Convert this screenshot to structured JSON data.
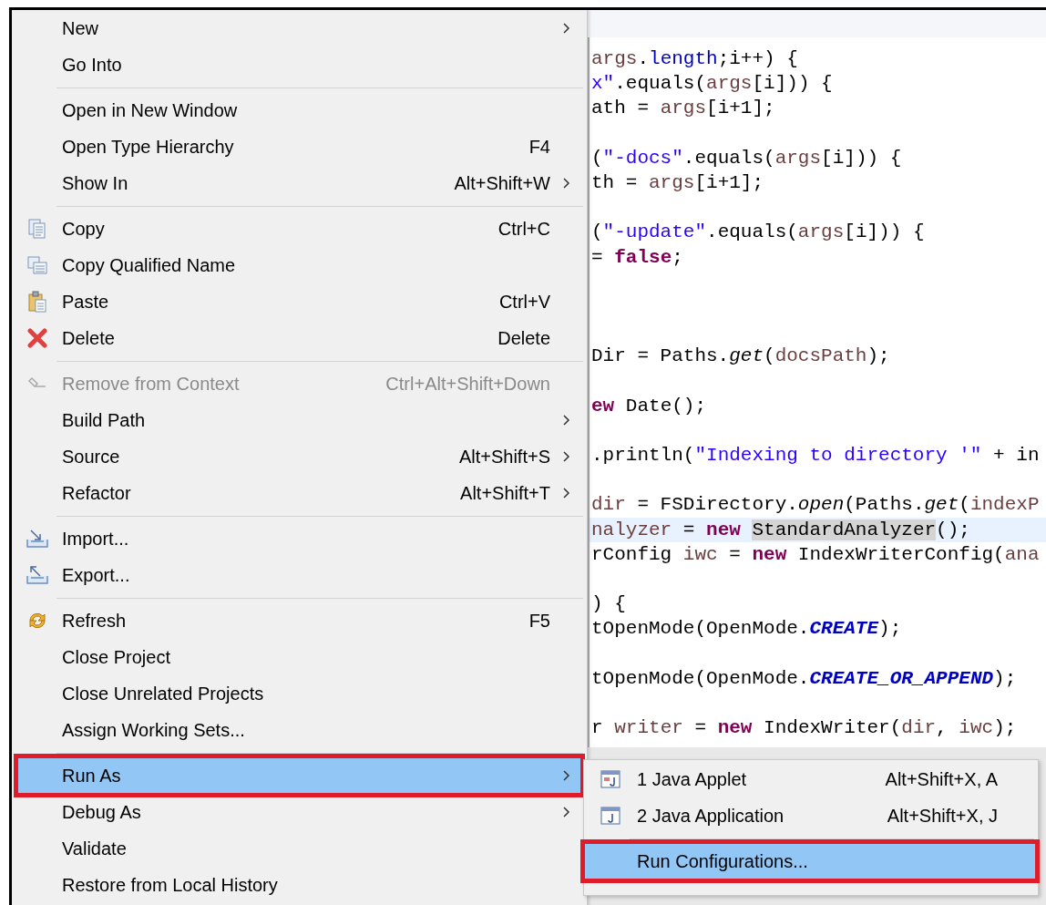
{
  "menu": {
    "items": [
      {
        "kind": "plain",
        "label": "New",
        "submenu": true,
        "selected": false,
        "disabled": false,
        "outlined": false
      },
      {
        "kind": "plain",
        "label": "Go Into",
        "submenu": false,
        "selected": false,
        "disabled": false,
        "outlined": false
      },
      {
        "kind": "separator"
      },
      {
        "kind": "plain",
        "label": "Open in New Window",
        "submenu": false,
        "selected": false,
        "disabled": false,
        "outlined": false
      },
      {
        "kind": "plain",
        "label": "Open Type Hierarchy",
        "shortcut": "F4",
        "submenu": false,
        "selected": false,
        "disabled": false,
        "outlined": false
      },
      {
        "kind": "plain",
        "label": "Show In",
        "shortcut": "Alt+Shift+W",
        "submenu": true,
        "selected": false,
        "disabled": false,
        "outlined": false
      },
      {
        "kind": "separator"
      },
      {
        "kind": "copy",
        "label": "Copy",
        "shortcut": "Ctrl+C",
        "submenu": false,
        "selected": false,
        "disabled": false,
        "outlined": false
      },
      {
        "kind": "qualified",
        "label": "Copy Qualified Name",
        "submenu": false,
        "selected": false,
        "disabled": false,
        "outlined": false
      },
      {
        "kind": "paste",
        "label": "Paste",
        "shortcut": "Ctrl+V",
        "submenu": false,
        "selected": false,
        "disabled": false,
        "outlined": false
      },
      {
        "kind": "delete",
        "label": "Delete",
        "shortcut": "Delete",
        "submenu": false,
        "selected": false,
        "disabled": false,
        "outlined": false
      },
      {
        "kind": "separator"
      },
      {
        "kind": "remove",
        "label": "Remove from Context",
        "shortcut": "Ctrl+Alt+Shift+Down",
        "submenu": false,
        "selected": false,
        "disabled": true,
        "outlined": false
      },
      {
        "kind": "plain",
        "label": "Build Path",
        "submenu": true,
        "selected": false,
        "disabled": false,
        "outlined": false
      },
      {
        "kind": "plain",
        "label": "Source",
        "shortcut": "Alt+Shift+S",
        "submenu": true,
        "selected": false,
        "disabled": false,
        "outlined": false
      },
      {
        "kind": "plain",
        "label": "Refactor",
        "shortcut": "Alt+Shift+T",
        "submenu": true,
        "selected": false,
        "disabled": false,
        "outlined": false
      },
      {
        "kind": "separator"
      },
      {
        "kind": "import",
        "label": "Import...",
        "submenu": false,
        "selected": false,
        "disabled": false,
        "outlined": false
      },
      {
        "kind": "export",
        "label": "Export...",
        "submenu": false,
        "selected": false,
        "disabled": false,
        "outlined": false
      },
      {
        "kind": "separator"
      },
      {
        "kind": "refresh",
        "label": "Refresh",
        "shortcut": "F5",
        "submenu": false,
        "selected": false,
        "disabled": false,
        "outlined": false
      },
      {
        "kind": "plain",
        "label": "Close Project",
        "submenu": false,
        "selected": false,
        "disabled": false,
        "outlined": false
      },
      {
        "kind": "plain",
        "label": "Close Unrelated Projects",
        "submenu": false,
        "selected": false,
        "disabled": false,
        "outlined": false
      },
      {
        "kind": "plain",
        "label": "Assign Working Sets...",
        "submenu": false,
        "selected": false,
        "disabled": false,
        "outlined": false
      },
      {
        "kind": "separator"
      },
      {
        "kind": "plain",
        "label": "Run As",
        "submenu": true,
        "selected": true,
        "disabled": false,
        "outlined": true
      },
      {
        "kind": "plain",
        "label": "Debug As",
        "submenu": true,
        "selected": false,
        "disabled": false,
        "outlined": false
      },
      {
        "kind": "plain",
        "label": "Validate",
        "submenu": false,
        "selected": false,
        "disabled": false,
        "outlined": false
      },
      {
        "kind": "plain",
        "label": "Restore from Local History",
        "submenu": false,
        "selected": false,
        "disabled": false,
        "outlined": false
      }
    ]
  },
  "editor": {
    "lines": [
      {
        "kind": "code",
        "current": false,
        "tokens": [
          {
            "text": "args",
            "kind": "var"
          },
          {
            "text": ".",
            "kind": "plain"
          },
          {
            "text": "length",
            "kind": "field"
          },
          {
            "text": ";i++) {",
            "kind": "plain"
          }
        ]
      },
      {
        "kind": "code",
        "current": false,
        "tokens": [
          {
            "text": "x\"",
            "kind": "string"
          },
          {
            "text": ".equals(",
            "kind": "plain"
          },
          {
            "text": "args",
            "kind": "var"
          },
          {
            "text": "[i])) {",
            "kind": "plain"
          }
        ]
      },
      {
        "kind": "code",
        "current": false,
        "tokens": [
          {
            "text": "ath = ",
            "kind": "plain"
          },
          {
            "text": "args",
            "kind": "var"
          },
          {
            "text": "[i+1];",
            "kind": "plain"
          }
        ]
      },
      {
        "kind": "blank"
      },
      {
        "kind": "code",
        "current": false,
        "tokens": [
          {
            "text": "(",
            "kind": "plain"
          },
          {
            "text": "\"-docs\"",
            "kind": "string"
          },
          {
            "text": ".equals(",
            "kind": "plain"
          },
          {
            "text": "args",
            "kind": "var"
          },
          {
            "text": "[i])) {",
            "kind": "plain"
          }
        ]
      },
      {
        "kind": "code",
        "current": false,
        "tokens": [
          {
            "text": "th = ",
            "kind": "plain"
          },
          {
            "text": "args",
            "kind": "var"
          },
          {
            "text": "[i+1];",
            "kind": "plain"
          }
        ]
      },
      {
        "kind": "blank"
      },
      {
        "kind": "code",
        "current": false,
        "tokens": [
          {
            "text": "(",
            "kind": "plain"
          },
          {
            "text": "\"-update\"",
            "kind": "string"
          },
          {
            "text": ".equals(",
            "kind": "plain"
          },
          {
            "text": "args",
            "kind": "var"
          },
          {
            "text": "[i])) {",
            "kind": "plain"
          }
        ]
      },
      {
        "kind": "code",
        "current": false,
        "tokens": [
          {
            "text": "= ",
            "kind": "plain"
          },
          {
            "text": "false",
            "kind": "keyword"
          },
          {
            "text": ";",
            "kind": "plain"
          }
        ]
      },
      {
        "kind": "blank"
      },
      {
        "kind": "blank"
      },
      {
        "kind": "blank"
      },
      {
        "kind": "code",
        "current": false,
        "tokens": [
          {
            "text": "Dir = Paths.",
            "kind": "plain"
          },
          {
            "text": "get",
            "kind": "static"
          },
          {
            "text": "(",
            "kind": "plain"
          },
          {
            "text": "docsPath",
            "kind": "var"
          },
          {
            "text": ");",
            "kind": "plain"
          }
        ]
      },
      {
        "kind": "blank"
      },
      {
        "kind": "code",
        "current": false,
        "tokens": [
          {
            "text": "ew",
            "kind": "keyword"
          },
          {
            "text": " Date();",
            "kind": "plain"
          }
        ]
      },
      {
        "kind": "blank"
      },
      {
        "kind": "code",
        "current": false,
        "tokens": [
          {
            "text": ".println(",
            "kind": "plain"
          },
          {
            "text": "\"Indexing to directory '\"",
            "kind": "string"
          },
          {
            "text": " + in",
            "kind": "plain"
          }
        ]
      },
      {
        "kind": "blank"
      },
      {
        "kind": "code",
        "current": false,
        "tokens": [
          {
            "text": "dir",
            "kind": "var"
          },
          {
            "text": " = FSDirectory.",
            "kind": "plain"
          },
          {
            "text": "open",
            "kind": "static"
          },
          {
            "text": "(Paths.",
            "kind": "plain"
          },
          {
            "text": "get",
            "kind": "static"
          },
          {
            "text": "(",
            "kind": "plain"
          },
          {
            "text": "indexP",
            "kind": "var"
          }
        ]
      },
      {
        "kind": "code",
        "current": true,
        "tokens": [
          {
            "text": "nalyzer",
            "kind": "var"
          },
          {
            "text": " = ",
            "kind": "plain"
          },
          {
            "text": "new ",
            "kind": "keyword"
          },
          {
            "text": "StandardAnalyzer",
            "kind": "occurrence"
          },
          {
            "text": "();",
            "kind": "plain"
          }
        ]
      },
      {
        "kind": "code",
        "current": false,
        "tokens": [
          {
            "text": "rConfig ",
            "kind": "plain"
          },
          {
            "text": "iwc",
            "kind": "var"
          },
          {
            "text": " = ",
            "kind": "plain"
          },
          {
            "text": "new",
            "kind": "keyword"
          },
          {
            "text": " IndexWriterConfig(",
            "kind": "plain"
          },
          {
            "text": "ana",
            "kind": "var"
          }
        ]
      },
      {
        "kind": "blank"
      },
      {
        "kind": "code",
        "current": false,
        "tokens": [
          {
            "text": ") {",
            "kind": "plain"
          }
        ]
      },
      {
        "kind": "code",
        "current": false,
        "tokens": [
          {
            "text": "tOpenMode(OpenMode.",
            "kind": "plain"
          },
          {
            "text": "CREATE",
            "kind": "constant"
          },
          {
            "text": ");",
            "kind": "plain"
          }
        ]
      },
      {
        "kind": "blank"
      },
      {
        "kind": "code",
        "current": false,
        "tokens": [
          {
            "text": "tOpenMode(OpenMode.",
            "kind": "plain"
          },
          {
            "text": "CREATE_OR_APPEND",
            "kind": "constant"
          },
          {
            "text": ");",
            "kind": "plain"
          }
        ]
      },
      {
        "kind": "blank"
      },
      {
        "kind": "code",
        "current": false,
        "tokens": [
          {
            "text": "r ",
            "kind": "plain"
          },
          {
            "text": "writer",
            "kind": "var"
          },
          {
            "text": " = ",
            "kind": "plain"
          },
          {
            "text": "new",
            "kind": "keyword"
          },
          {
            "text": " IndexWriter(",
            "kind": "plain"
          },
          {
            "text": "dir",
            "kind": "var"
          },
          {
            "text": ", ",
            "kind": "plain"
          },
          {
            "text": "iwc",
            "kind": "var"
          },
          {
            "text": ");",
            "kind": "plain"
          }
        ]
      }
    ]
  },
  "submenu": {
    "items": [
      {
        "kind": "applet",
        "label": "1 Java Applet",
        "shortcut": "Alt+Shift+X, A",
        "selected": false,
        "outlined": false
      },
      {
        "kind": "application",
        "label": "2 Java Application",
        "shortcut": "Alt+Shift+X, J",
        "selected": false,
        "outlined": false
      },
      {
        "kind": "separator"
      },
      {
        "kind": "plain",
        "label": "Run Configurations...",
        "selected": true,
        "outlined": true
      }
    ]
  }
}
